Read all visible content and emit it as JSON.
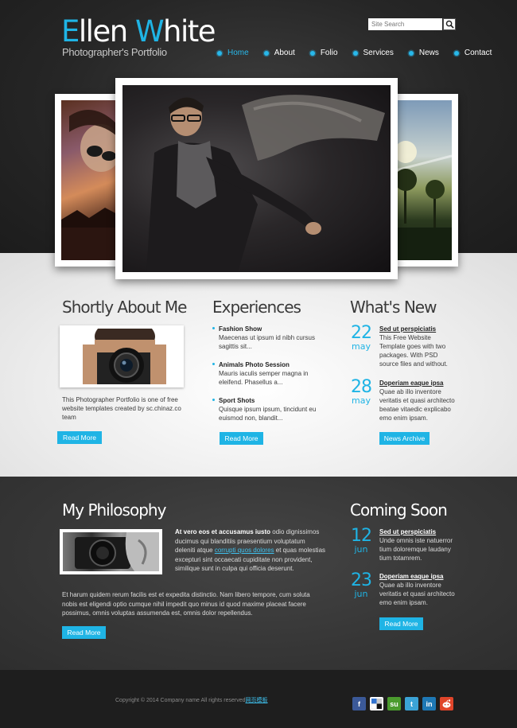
{
  "header": {
    "logo_first": "Ellen",
    "logo_first_letter": "E",
    "logo_last": "White",
    "logo_last_letter": "W",
    "tagline": "Photographer's Portfolio",
    "search_placeholder": "Site Search"
  },
  "nav": {
    "items": [
      {
        "label": "Home"
      },
      {
        "label": "About"
      },
      {
        "label": "Folio"
      },
      {
        "label": "Services"
      },
      {
        "label": "News"
      },
      {
        "label": "Contact"
      }
    ]
  },
  "about": {
    "title": "Shortly About Me",
    "text": "This Photographer Portfolio is one of free website templates created by sc.chinaz.co team",
    "button": "Read More"
  },
  "experiences": {
    "title": "Experiences",
    "items": [
      {
        "title": "Fashion Show",
        "desc": "Maecenas ut ipsum id nibh cursus sagittis sit..."
      },
      {
        "title": "Animals Photo Session",
        "desc": "Mauris iaculis semper magna in eleifend. Phasellus a..."
      },
      {
        "title": "Sport Shots",
        "desc": "Quisque ipsum ipsum, tincidunt eu euismod non, blandit..."
      }
    ],
    "button": "Read More"
  },
  "whats_new": {
    "title": "What's New",
    "items": [
      {
        "day": "22",
        "month": "may",
        "title": "Sed ut perspiciatis",
        "desc": "This Free Website Template goes with two packages. With PSD source files and without."
      },
      {
        "day": "28",
        "month": "may",
        "title": "Doperiam eaque ipsa",
        "desc": "Quae ab illo inventore veritatis et quasi architecto beatae vitaedic explicabo emo enim ipsam."
      }
    ],
    "button": "News Archive"
  },
  "philosophy": {
    "title": "My Philosophy",
    "bold_lead": "At vero eos et accusamus iusto",
    "para1_a": " odio dignissimos ducimus qui blanditiis praesentium voluptatum deleniti atque ",
    "para1_link": "corrupti quos dolores",
    "para1_b": " et quas molestias excepturi sint occaecati cupiditate non provident, similique sunt in culpa qui officia deserunt.",
    "para2": "Et harum quidem rerum facilis est et expedita distinctio. Nam libero tempore, cum soluta nobis est eligendi optio cumque nihil impedit quo minus id quod maxime placeat facere possimus, omnis voluptas assumenda est, omnis dolor repellendus.",
    "button": "Read More"
  },
  "coming_soon": {
    "title": "Coming Soon",
    "items": [
      {
        "day": "12",
        "month": "jun",
        "title": "Sed ut perspiciatis",
        "desc": "Unde omnis iste natuerror tium doloremque laudany tium totamrem."
      },
      {
        "day": "23",
        "month": "jun",
        "title": "Doperiam eaque ipsa",
        "desc": "Quae ab illo inventore veritatis et quasi architecto emo enim ipsam."
      }
    ],
    "button": "Read More"
  },
  "footer": {
    "copyright": "Copyright © 2014 Company name All rights reserved",
    "icp_link": "网页模板"
  },
  "social": [
    {
      "icon": "facebook-icon",
      "glyph": "f",
      "color": "#3b5998"
    },
    {
      "icon": "delicious-icon",
      "glyph": "",
      "color": "#3274d1"
    },
    {
      "icon": "stumbleupon-icon",
      "glyph": "su",
      "color": "#4b9b2e"
    },
    {
      "icon": "twitter-icon",
      "glyph": "t",
      "color": "#3ba3d6"
    },
    {
      "icon": "linkedin-icon",
      "glyph": "in",
      "color": "#1e78b5"
    },
    {
      "icon": "reddit-icon",
      "glyph": "●",
      "color": "#e0452a"
    }
  ],
  "colors": {
    "accent": "#1fb4e5",
    "dark_bg": "#262626",
    "light_bg": "#ececec"
  }
}
